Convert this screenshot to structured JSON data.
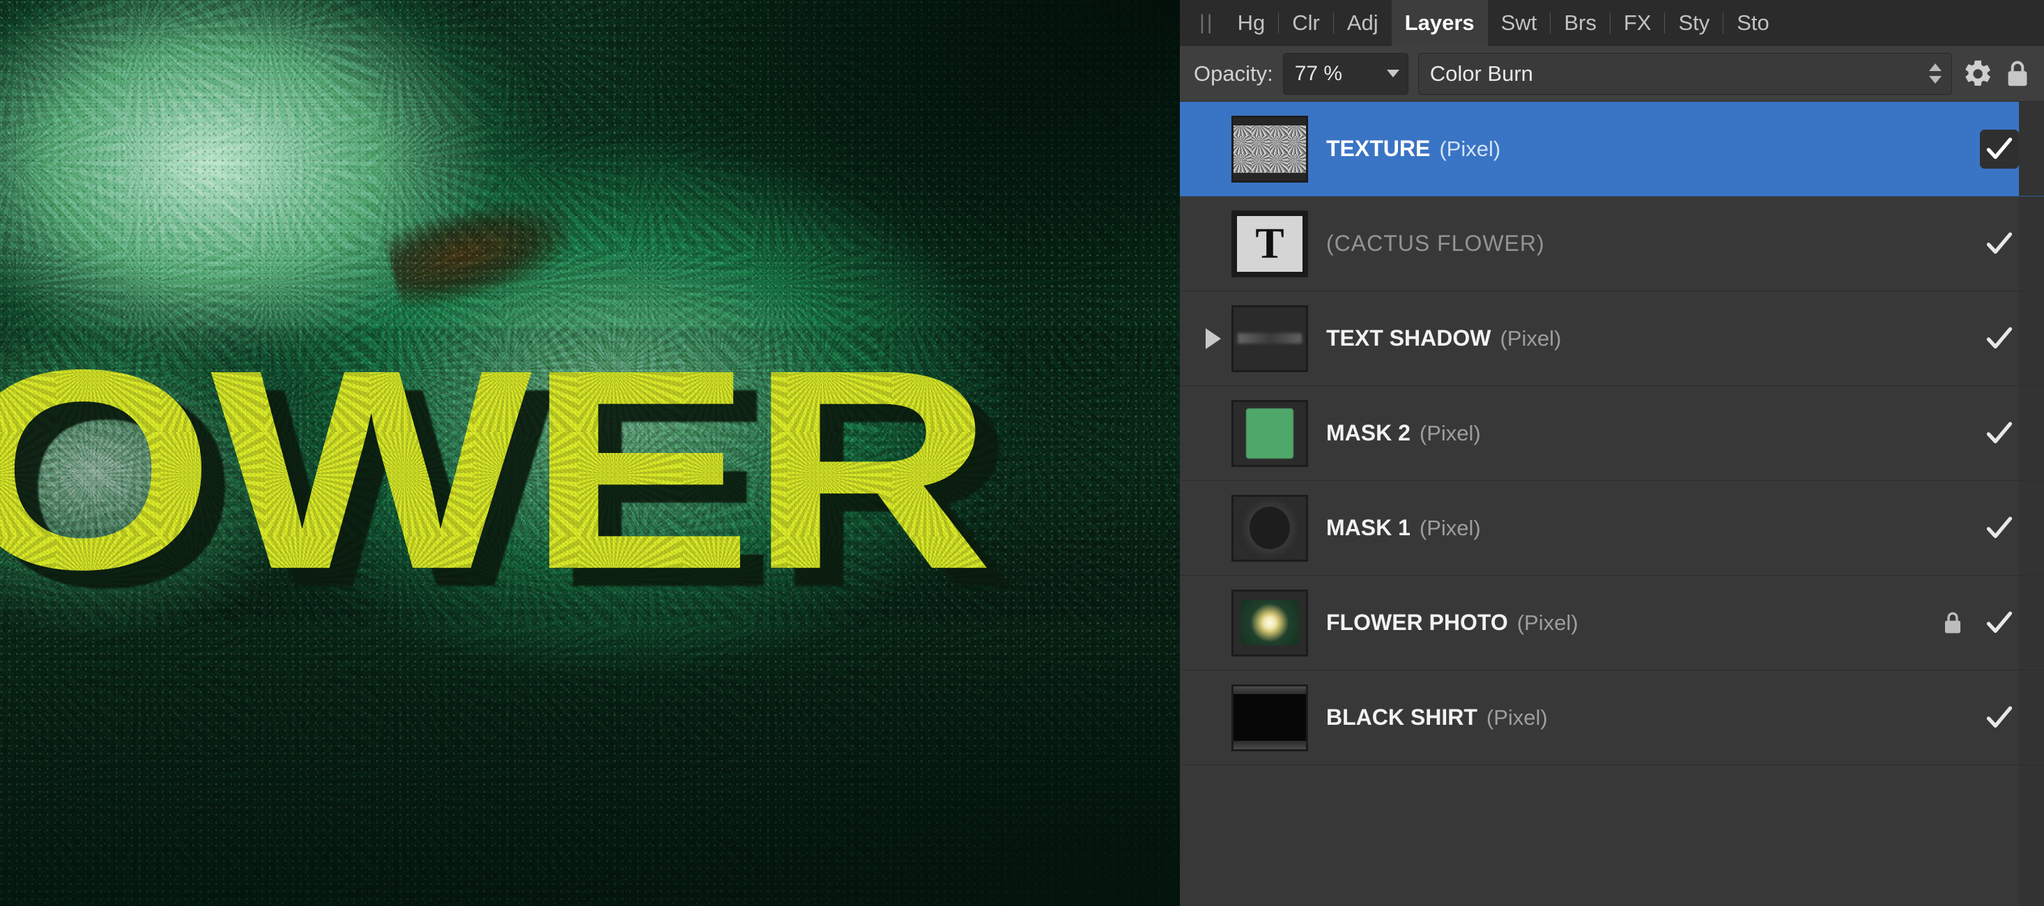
{
  "panel": {
    "drag_handle": "||",
    "tabs": [
      {
        "label": "Hg",
        "active": false
      },
      {
        "label": "Clr",
        "active": false
      },
      {
        "label": "Adj",
        "active": false
      },
      {
        "label": "Layers",
        "active": true
      },
      {
        "label": "Swt",
        "active": false
      },
      {
        "label": "Brs",
        "active": false
      },
      {
        "label": "FX",
        "active": false
      },
      {
        "label": "Sty",
        "active": false
      },
      {
        "label": "Sto",
        "active": false
      }
    ]
  },
  "toolbar": {
    "opacity_label": "Opacity:",
    "opacity_value": "77 %",
    "blend_mode": "Color Burn",
    "gear_icon": "gear-icon",
    "lock_icon": "lock-icon",
    "dropdown_icon": "chevron-down-icon",
    "stepper_icon": "stepper-arrows-icon"
  },
  "layers": [
    {
      "name": "TEXTURE",
      "kind": "(Pixel)",
      "thumb": "noise",
      "selected": true,
      "dim": false,
      "expandable": false,
      "locked": false,
      "visible": true
    },
    {
      "name": "(CACTUS FLOWER)",
      "kind": "",
      "thumb": "text",
      "thumb_glyph": "T",
      "selected": false,
      "dim": true,
      "expandable": false,
      "locked": false,
      "visible": true
    },
    {
      "name": "TEXT SHADOW",
      "kind": "(Pixel)",
      "thumb": "shadow",
      "selected": false,
      "dim": false,
      "expandable": true,
      "locked": false,
      "visible": true
    },
    {
      "name": "MASK 2",
      "kind": "(Pixel)",
      "thumb": "green",
      "selected": false,
      "dim": false,
      "expandable": false,
      "locked": false,
      "visible": true
    },
    {
      "name": "MASK 1",
      "kind": "(Pixel)",
      "thumb": "mask1",
      "selected": false,
      "dim": false,
      "expandable": false,
      "locked": false,
      "visible": true
    },
    {
      "name": "FLOWER PHOTO",
      "kind": "(Pixel)",
      "thumb": "photo",
      "selected": false,
      "dim": false,
      "expandable": false,
      "locked": true,
      "visible": true
    },
    {
      "name": "BLACK SHIRT",
      "kind": "(Pixel)",
      "thumb": "black",
      "selected": false,
      "dim": false,
      "expandable": false,
      "locked": false,
      "visible": true
    }
  ],
  "canvas": {
    "artwork_text": "OWER",
    "text_color": "#dff028",
    "shadow_color": "#0c1f10",
    "background_description": "green grunge texture"
  },
  "colors": {
    "selection_blue": "#3a74c4",
    "panel_bg": "#383838",
    "toolbar_bg": "#3f3f3f",
    "tabstrip_bg": "#2b2b2b",
    "text_primary": "#f2f2f2",
    "text_muted": "#9e9e9e"
  }
}
